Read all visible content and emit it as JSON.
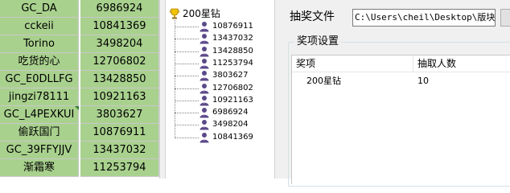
{
  "sheet": {
    "rows": [
      {
        "name": "GC_DA",
        "id": "6986924"
      },
      {
        "name": "cckeii",
        "id": "10841369"
      },
      {
        "name": "Torino",
        "id": "3498204"
      },
      {
        "name": "吃货的心",
        "id": "12706802"
      },
      {
        "name": "GC_E0DLLFG",
        "id": "13428850"
      },
      {
        "name": "jingzi78111",
        "id": "10921163"
      },
      {
        "name": "GC_L4PEXKUI",
        "id": "3803627"
      },
      {
        "name": "偷跃国门",
        "id": "10876911"
      },
      {
        "name": "GC_39FFYJJV",
        "id": "13437032"
      },
      {
        "name": "渐霜寒",
        "id": "11253794"
      }
    ]
  },
  "tree": {
    "root_label": "200星钻",
    "root_icon": "trophy-icon",
    "node_icon": "user-icon",
    "nodes": [
      "10876911",
      "13437032",
      "13428850",
      "11253794",
      "3803627",
      "12706802",
      "10921163",
      "6986924",
      "3498204",
      "10841369"
    ]
  },
  "settings": {
    "file_label": "抽奖文件",
    "file_path": "C:\\Users\\cheil\\Desktop\\版块活",
    "group_title": "奖项设置",
    "columns": {
      "prize": "奖项",
      "count": "抽取人数"
    },
    "rows": [
      {
        "prize": "200星钻",
        "count": "10"
      }
    ]
  },
  "colors": {
    "cell_fill": "#a9d18e",
    "panel_bg": "#f0f0f0",
    "trophy": "#f2c200",
    "user_icon": "#5b4a8a"
  }
}
